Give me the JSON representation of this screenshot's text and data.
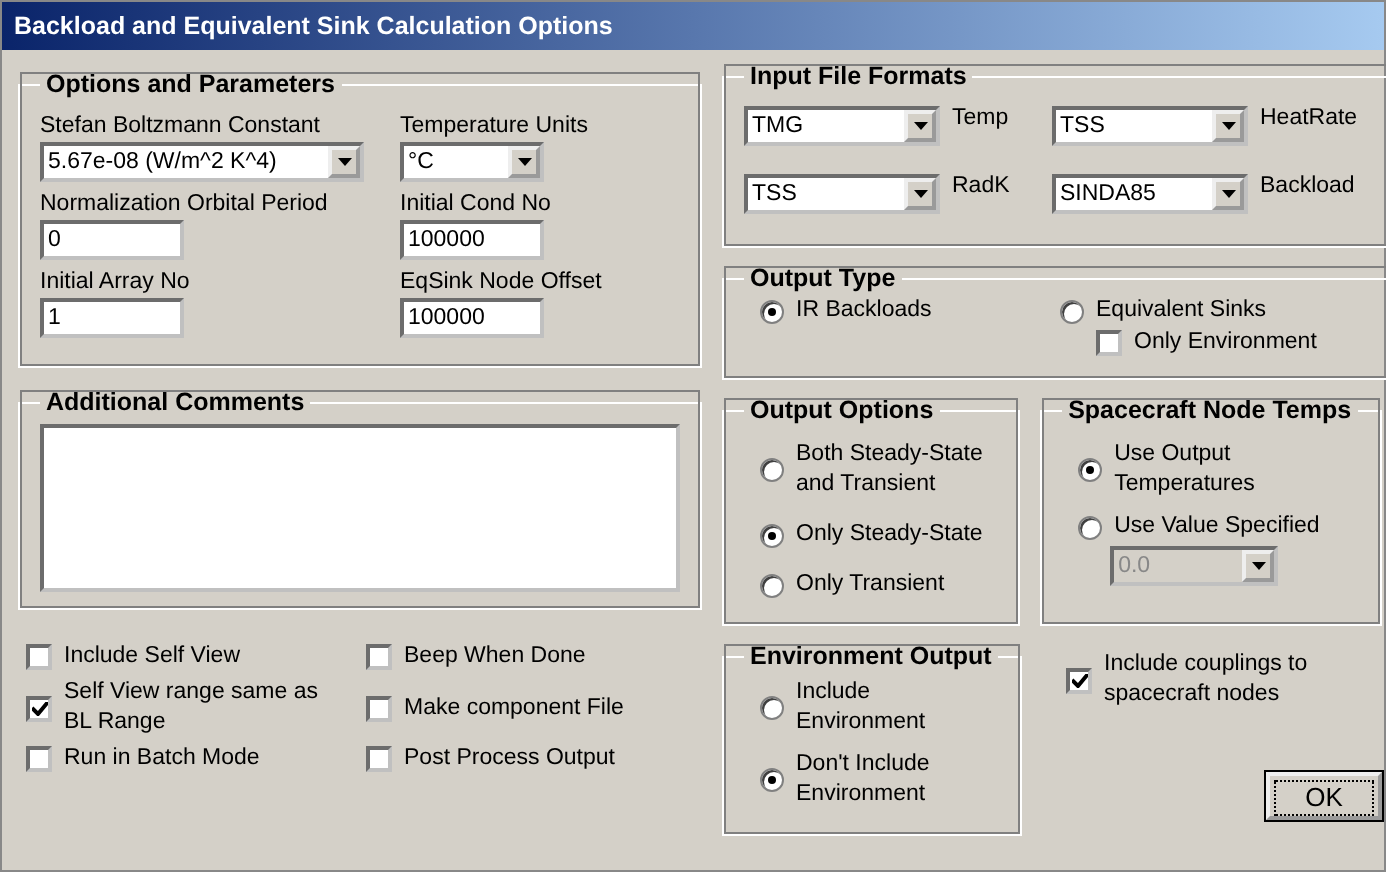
{
  "window": {
    "title": "Backload and Equivalent Sink Calculation Options"
  },
  "options_and_parameters": {
    "title": "Options and Parameters",
    "fields": [
      {
        "label": "Stefan Boltzmann Constant",
        "kind": "combo",
        "value": "5.67e-08 (W/m^2 K^4)"
      },
      {
        "label": "Temperature Units",
        "kind": "combo",
        "value": "°C"
      },
      {
        "label": "Normalization Orbital Period",
        "kind": "text",
        "value": "0"
      },
      {
        "label": "Initial Cond No",
        "kind": "text",
        "value": "100000"
      },
      {
        "label": "Initial Array No",
        "kind": "text",
        "value": "1"
      },
      {
        "label": "EqSink Node Offset",
        "kind": "text",
        "value": "100000"
      }
    ]
  },
  "additional_comments": {
    "title": "Additional Comments"
  },
  "checkboxes": [
    {
      "label": "Include Self View",
      "checked": false
    },
    {
      "label": "Beep When Done",
      "checked": false
    },
    {
      "label": "Self View range same as BL Range",
      "checked": true
    },
    {
      "label": "Make component File",
      "checked": false
    },
    {
      "label": "Run in Batch Mode",
      "checked": false
    },
    {
      "label": "Post Process Output",
      "checked": false
    }
  ],
  "input_file_formats": {
    "title": "Input File Formats",
    "combos": [
      {
        "file_type": "Temp",
        "format": "TMG"
      },
      {
        "file_type": "HeatRate",
        "format": "TSS"
      },
      {
        "file_type": "RadK",
        "format": "TSS"
      },
      {
        "file_type": "Backload",
        "format": "SINDA85"
      }
    ]
  },
  "output_type": {
    "title": "Output Type",
    "options": [
      {
        "label": "IR Backloads",
        "selected": true
      },
      {
        "label": "Equivalent Sinks",
        "selected": false
      }
    ],
    "only_environment": {
      "label": "Only Environment",
      "checked": false
    }
  },
  "output_options": {
    "title": "Output Options",
    "options": [
      {
        "label": "Both Steady-State and Transient",
        "selected": false
      },
      {
        "label": "Only Steady-State",
        "selected": true
      },
      {
        "label": "Only Transient",
        "selected": false
      }
    ]
  },
  "spacecraft_node_temps": {
    "title": "Spacecraft Node Temps",
    "options": [
      {
        "label": "Use Output Temperatures",
        "selected": true
      },
      {
        "label": "Use Value Specified",
        "selected": false
      }
    ],
    "value_combo": {
      "value": "0.0",
      "disabled": true
    }
  },
  "environment_output": {
    "title": "Environment Output",
    "options": [
      {
        "label": "Include Environment",
        "selected": false
      },
      {
        "label": "Don't Include Environment",
        "selected": true
      }
    ]
  },
  "include_couplings": {
    "label": "Include couplings to spacecraft nodes",
    "checked": true
  },
  "ok_button": {
    "label": "OK"
  }
}
